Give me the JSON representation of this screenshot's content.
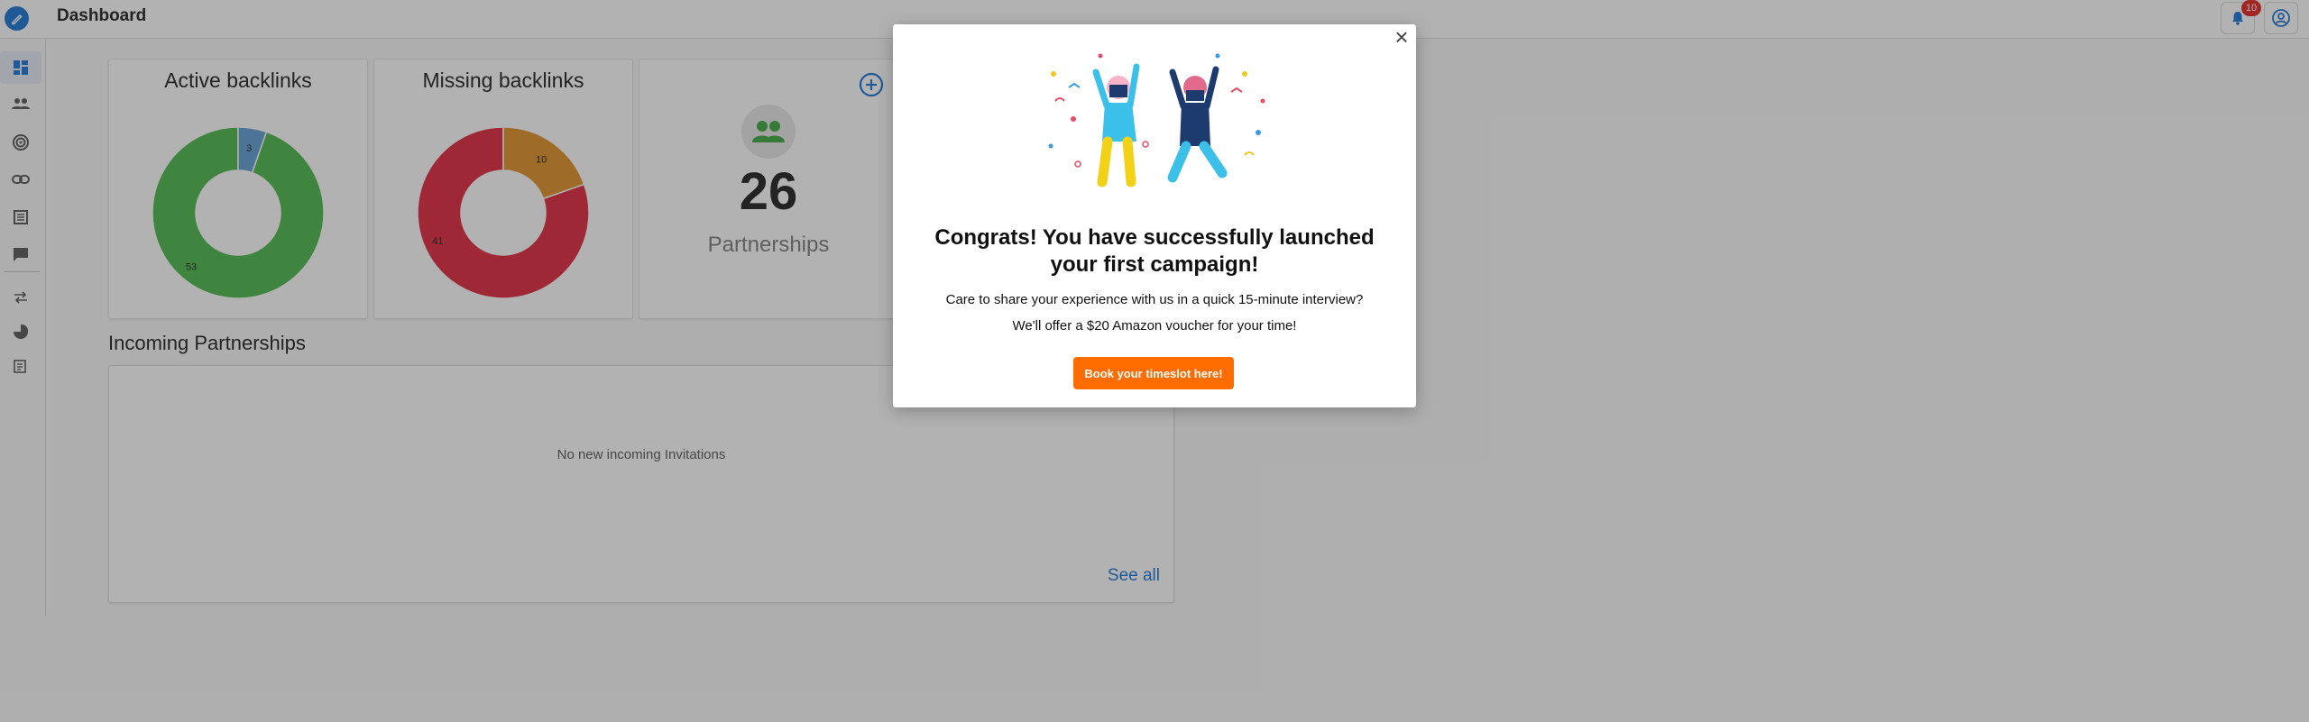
{
  "header": {
    "title": "Dashboard",
    "notification_count": "10"
  },
  "colors": {
    "accent": "#2f80d8",
    "active_green": "#5bbd5b",
    "active_blue": "#6ea6d9",
    "missing_red": "#e23a4d",
    "missing_orange": "#e29a3a",
    "cta_orange": "#ff6d00",
    "badge_red": "#e53935"
  },
  "sidebar": {
    "items": [
      {
        "icon": "dashboard-icon",
        "active": true
      },
      {
        "icon": "people-icon"
      },
      {
        "icon": "target-icon"
      },
      {
        "icon": "link-icon"
      },
      {
        "icon": "list-icon"
      },
      {
        "icon": "chat-icon"
      },
      {
        "icon": "swap-icon"
      },
      {
        "icon": "pie-chart-icon"
      },
      {
        "icon": "report-icon"
      }
    ]
  },
  "cards": {
    "active_backlinks": {
      "title": "Active backlinks"
    },
    "missing_backlinks": {
      "title": "Missing backlinks"
    },
    "partnerships": {
      "value": "26",
      "label": "Partnerships"
    }
  },
  "chart_data": [
    {
      "type": "pie",
      "title": "Active backlinks",
      "categories": [
        "",
        ""
      ],
      "values": [
        53,
        3
      ]
    },
    {
      "type": "pie",
      "title": "Missing backlinks",
      "categories": [
        "",
        ""
      ],
      "values": [
        41,
        10
      ]
    }
  ],
  "incoming": {
    "title": "Incoming Partnerships",
    "empty_text": "No new incoming Invitations",
    "see_all": "See all"
  },
  "modal": {
    "title": "Congrats! You have successfully launched your first campaign!",
    "line1": "Care to share your experience with us in a quick 15-minute interview?",
    "line2": "We'll offer a $20 Amazon voucher for your time!",
    "cta": "Book your timeslot here!",
    "close": "×"
  }
}
